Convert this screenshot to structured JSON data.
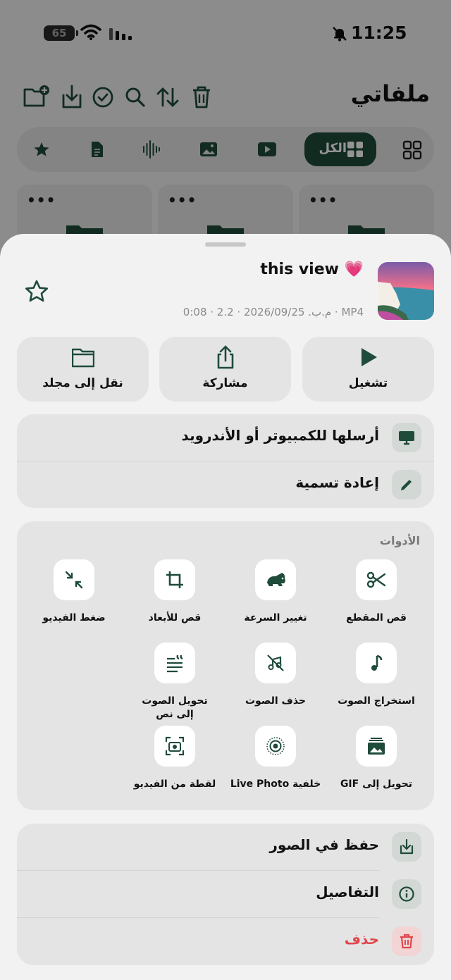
{
  "status_bar": {
    "battery": "65",
    "time": "11:25"
  },
  "app": {
    "title": "ملفاتي",
    "filter_all_label": "الكل",
    "card_menu": "•••"
  },
  "sheet": {
    "file_name": "this view 💗",
    "file_meta": "م.ب. 2026/09/25 · 2.2 · 0:08 · MP4",
    "actions": {
      "play": "تشغيل",
      "share": "مشاركة",
      "move": "نقل إلى مجلد"
    },
    "send_to_computer": "أرسلها للكمبيوتر أو الأندرويد",
    "rename": "إعادة تسمية",
    "tools_title": "الأدوات",
    "tools": {
      "trim": "قص المقطع",
      "speed": "تغيير السرعة",
      "crop": "قص للأبعاد",
      "compress": "ضغط الفيديو",
      "extract_audio": "استخراج الصوت",
      "remove_audio": "حذف الصوت",
      "transcribe_line1": "تحويل الصوت",
      "transcribe_line2": "إلى نص",
      "to_gif": "تحويل إلى GIF",
      "live_photo": "خلفية Live Photo",
      "snapshot": "لقطة من الفيديو"
    },
    "save_to_photos": "حفظ في الصور",
    "details": "التفاصيل",
    "delete": "حذف"
  },
  "colors": {
    "accent": "#1f4b3a",
    "danger": "#e0474c",
    "sheet_bg": "#f2f2f2",
    "card_bg": "#e4e4e4"
  }
}
